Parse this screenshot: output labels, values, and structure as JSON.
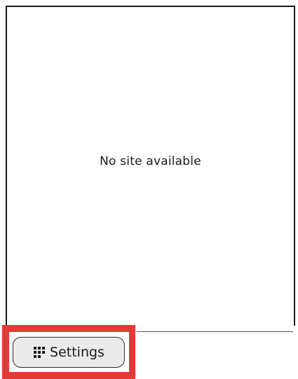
{
  "main": {
    "empty_message": "No site available"
  },
  "footer": {
    "settings_label": "Settings",
    "settings_icon": "grid-icon"
  },
  "colors": {
    "highlight": "#e53935",
    "button_bg": "#ebebeb",
    "border": "#1a1a1a"
  }
}
